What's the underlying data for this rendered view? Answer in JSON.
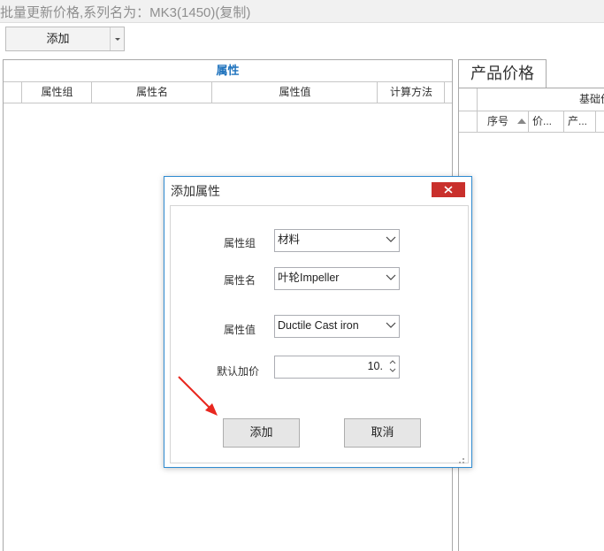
{
  "window": {
    "title": "批量更新价格,系列名为：MK3(1450)(复制)"
  },
  "toolbar": {
    "add_label": "添加"
  },
  "attr_panel": {
    "header": "属性",
    "columns": [
      "属性组",
      "属性名",
      "属性值",
      "计算方法"
    ]
  },
  "price_panel": {
    "tab_label": "产品价格",
    "group_header": "基础价",
    "columns": [
      "序号",
      "价...",
      "产..."
    ]
  },
  "dialog": {
    "title": "添加属性",
    "fields": {
      "group": {
        "label": "属性组",
        "value": "材料"
      },
      "name": {
        "label": "属性名",
        "value": "叶轮Impeller"
      },
      "value": {
        "label": "属性值",
        "value": "Ductile Cast iron"
      },
      "price": {
        "label": "默认加价",
        "value": "10."
      }
    },
    "add_button": "添加",
    "cancel_button": "取消"
  },
  "colors": {
    "accent_blue": "#1e72bd",
    "dialog_border": "#2f8bd1",
    "close_red": "#c9302c",
    "annotation_red": "#e8271f"
  },
  "icons": [
    "chevron-down-icon",
    "close-icon",
    "spinner-up-icon",
    "spinner-down-icon",
    "sort-up-icon",
    "resize-grip-icon",
    "red-arrow-annotation"
  ]
}
